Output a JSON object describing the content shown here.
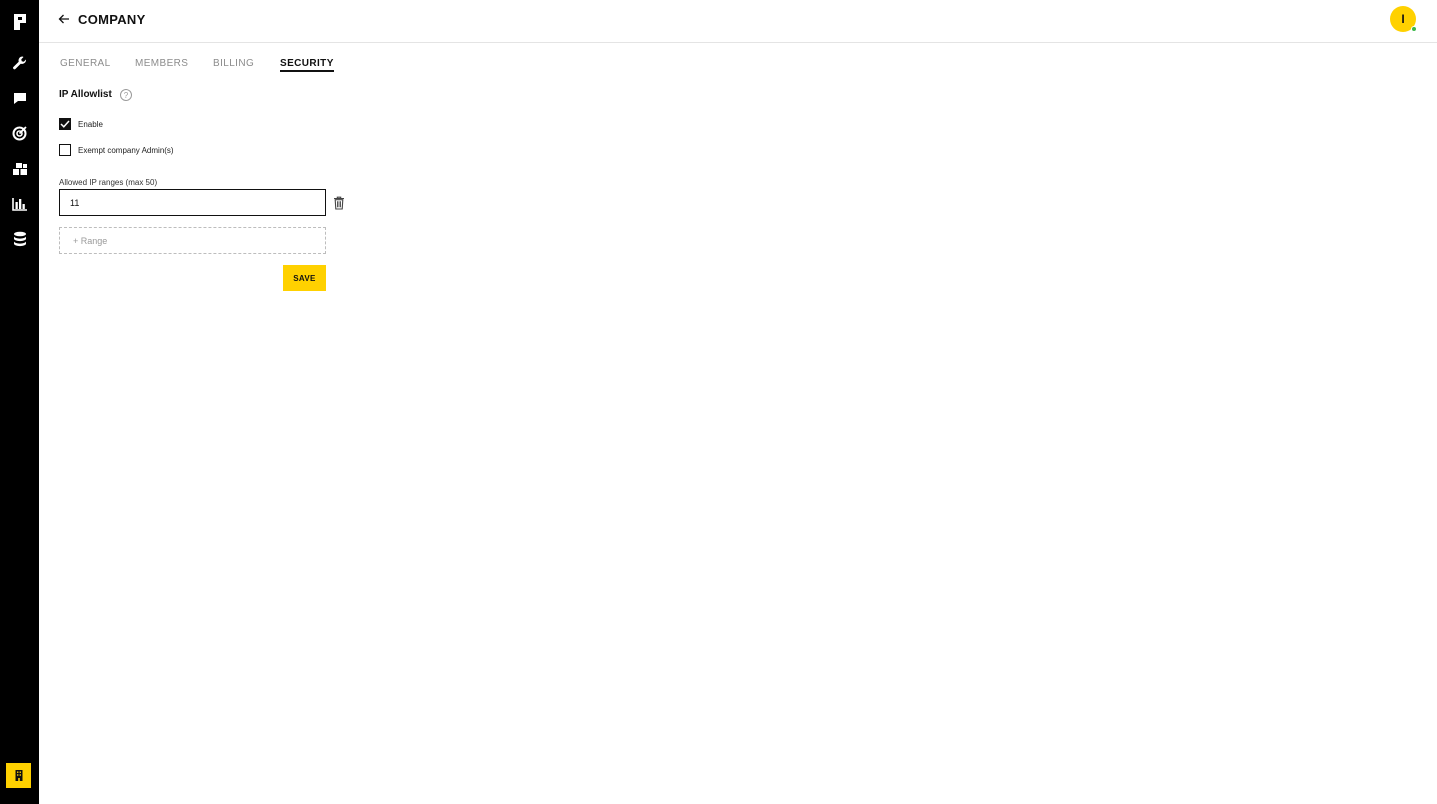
{
  "colors": {
    "accent": "#ffd100",
    "sidebar_bg": "#000000",
    "status_online": "#3cb84a"
  },
  "sidebar": {
    "items": [
      {
        "icon": "logo-icon"
      },
      {
        "icon": "wrench-icon"
      },
      {
        "icon": "chat-icon"
      },
      {
        "icon": "target-icon"
      },
      {
        "icon": "blocks-icon"
      },
      {
        "icon": "bar-chart-icon"
      },
      {
        "icon": "database-icon"
      }
    ],
    "bottom_icon": "building-icon"
  },
  "header": {
    "title": "COMPANY",
    "back_icon": "arrow-left-icon",
    "avatar_initial": "I"
  },
  "tabs": [
    {
      "label": "GENERAL",
      "active": false
    },
    {
      "label": "MEMBERS",
      "active": false
    },
    {
      "label": "BILLING",
      "active": false
    },
    {
      "label": "SECURITY",
      "active": true
    }
  ],
  "security": {
    "section_title": "IP Allowlist",
    "help_icon_glyph": "?",
    "enable_label": "Enable",
    "enable_checked": true,
    "exempt_label": "Exempt company Admin(s)",
    "exempt_checked": false,
    "ranges_label": "Allowed IP ranges (max 50)",
    "range_value": "11",
    "add_range_label": "+ Range",
    "save_label": "SAVE"
  }
}
